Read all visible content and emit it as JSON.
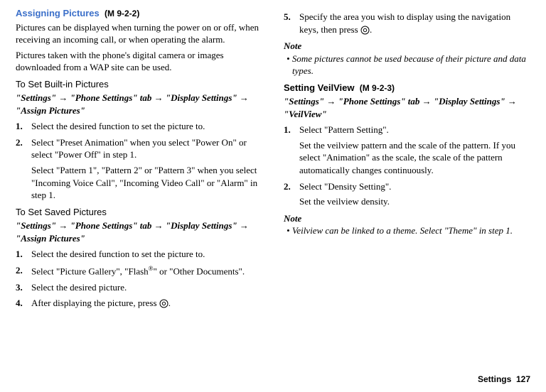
{
  "left": {
    "h1": "Assigning Pictures",
    "h1code": "(M 9-2-2)",
    "p1": "Pictures can be displayed when turning the power on or off, when receiving an incoming call, or when operating the alarm.",
    "p2": "Pictures taken with the phone's digital camera or images downloaded from a WAP site can be used.",
    "sub1": "To Set Built-in Pictures",
    "bc1_a": "\"Settings\"",
    "bc1_b": "\"Phone Settings\" tab",
    "bc1_c": "\"Display Settings\"",
    "bc1_d": "\"Assign Pictures\"",
    "s1_1": "Select the desired function to set the picture to.",
    "s1_2a": "Select \"Preset Animation\" when you select \"Power On\" or select \"Power Off\" in step 1.",
    "s1_2b": "Select \"Pattern 1\", \"Pattern 2\" or \"Pattern 3\" when you select \"Incoming Voice Call\", \"Incoming Video Call\" or \"Alarm\" in step 1.",
    "sub2": "To Set Saved Pictures",
    "s2_1": "Select the desired function to set the picture to.",
    "s2_2a": "Select \"Picture Gallery\", \"Flash",
    "s2_2b": "\" or \"Other Documents\".",
    "s2_3": "Select the desired picture.",
    "s2_4a": "After displaying the picture, press ",
    "s2_4b": "."
  },
  "right": {
    "s5a": "Specify the area you wish to display using the navigation keys, then press ",
    "s5b": ".",
    "note1h": "Note",
    "note1": "Some pictures cannot be used because of their picture and data types.",
    "h2": "Setting VeilView",
    "h2code": "(M 9-2-3)",
    "bc2_a": "\"Settings\"",
    "bc2_b": "\"Phone Settings\" tab",
    "bc2_c": "\"Display Settings\"",
    "bc2_d": "\"VeilView\"",
    "r1a": "Select \"Pattern Setting\".",
    "r1b": "Set the veilview pattern and the scale of the pattern. If you select \"Animation\" as the scale, the scale of the pattern automatically changes continuously.",
    "r2a": "Select \"Density Setting\".",
    "r2b": "Set the veilview density.",
    "note2h": "Note",
    "note2": "Veilview can be linked to a theme. Select \"Theme\" in step 1."
  },
  "footer": {
    "label": "Settings",
    "page": "127"
  }
}
